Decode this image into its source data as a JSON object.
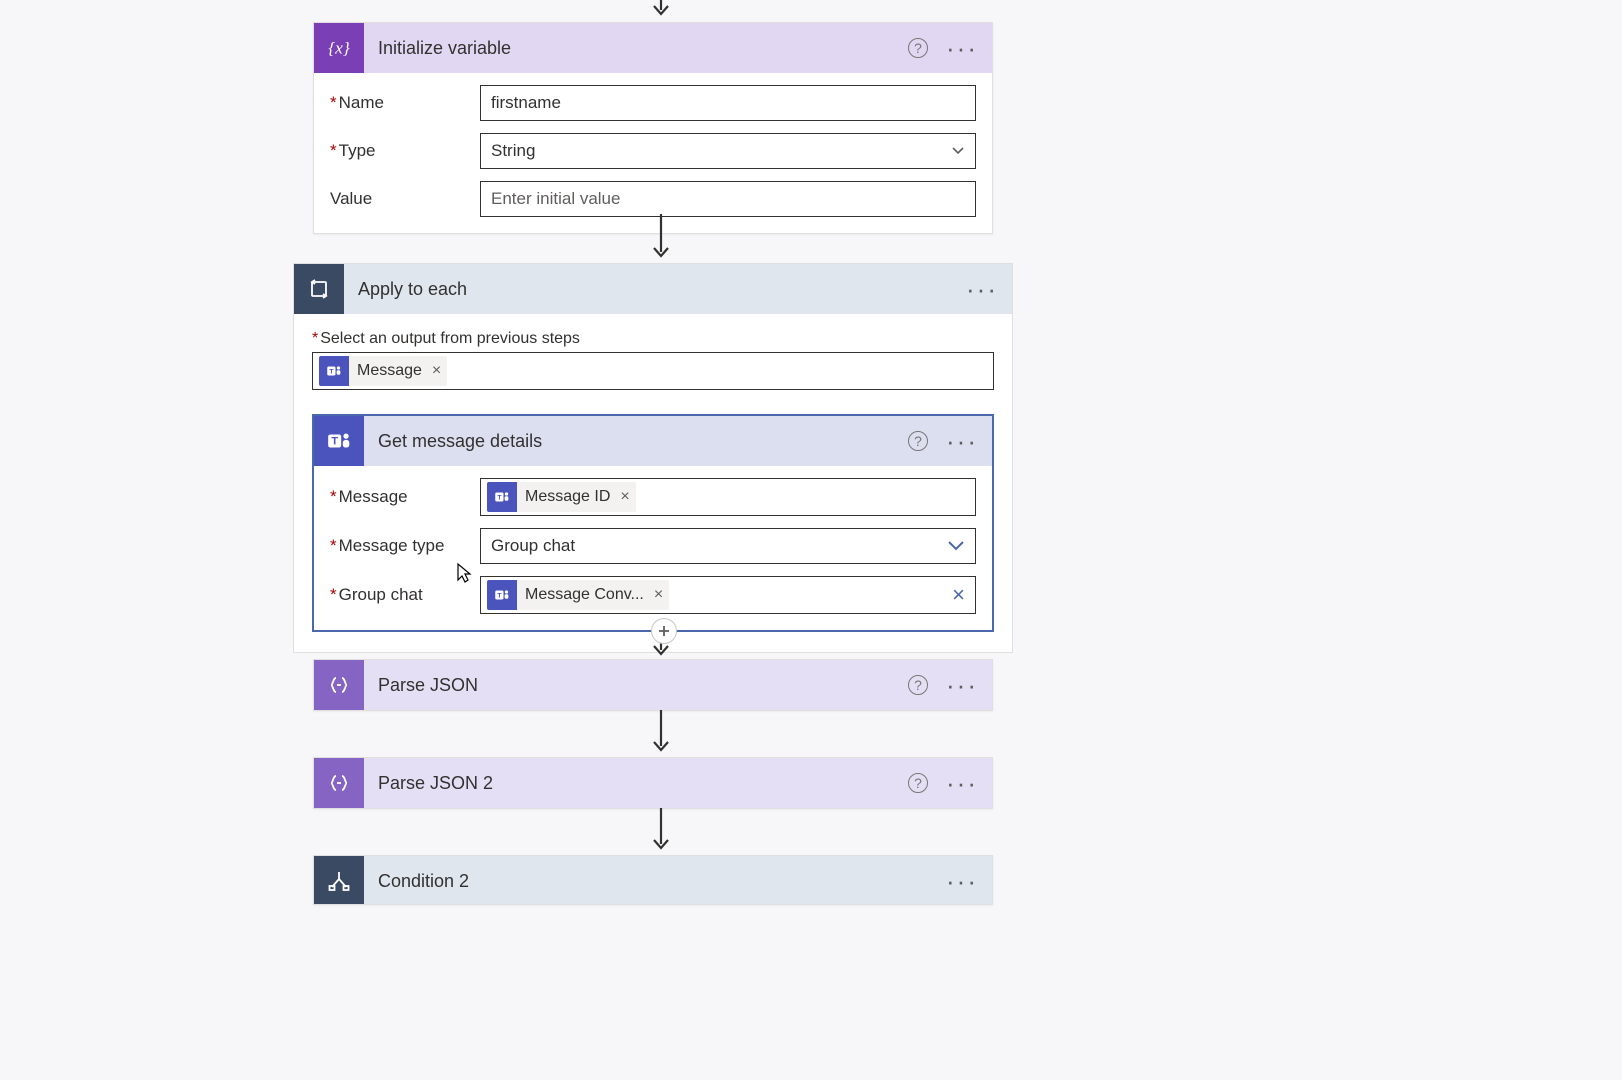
{
  "cards": {
    "init_var": {
      "title": "Initialize variable",
      "name_label": "Name",
      "name_value": "firstname",
      "type_label": "Type",
      "type_value": "String",
      "value_label": "Value",
      "value_placeholder": "Enter initial value"
    },
    "apply_each": {
      "title": "Apply to each",
      "select_label": "Select an output from previous steps",
      "token": "Message"
    },
    "get_msg": {
      "title": "Get message details",
      "message_label": "Message",
      "message_token": "Message ID",
      "type_label": "Message type",
      "type_value": "Group chat",
      "groupchat_label": "Group chat",
      "groupchat_token": "Message Conv..."
    },
    "parse_json": {
      "title": "Parse JSON"
    },
    "parse_json2": {
      "title": "Parse JSON 2"
    },
    "condition2": {
      "title": "Condition 2"
    }
  }
}
